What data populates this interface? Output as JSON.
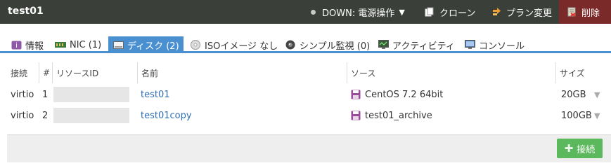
{
  "header": {
    "title": "test01",
    "power_label": "DOWN: 電源操作",
    "clone_label": "クローン",
    "plan_label": "プラン変更",
    "delete_label": "削除"
  },
  "tabs": [
    {
      "label": "情報"
    },
    {
      "label": "NIC (1)"
    },
    {
      "label": "ディスク (2)"
    },
    {
      "label": "ISOイメージ なし"
    },
    {
      "label": "シンプル監視 (0)"
    },
    {
      "label": "アクティビティ"
    },
    {
      "label": "コンソール"
    }
  ],
  "table": {
    "headers": [
      "接続",
      "#",
      "リソースID",
      "名前",
      "ソース",
      "サイズ"
    ],
    "rows": [
      {
        "connection": "virtio",
        "index": "1",
        "name": "test01",
        "source": "CentOS 7.2 64bit",
        "size": "20GB"
      },
      {
        "connection": "virtio",
        "index": "2",
        "name": "test01copy",
        "source": "test01_archive",
        "size": "100GB"
      }
    ]
  },
  "footer": {
    "connect_label": "接続"
  },
  "colors": {
    "header_bg": "#3a3f3a",
    "delete_bg": "#7b2a2a",
    "tab_active": "#4a8fd0",
    "link": "#2f6db5",
    "connect_button": "#5cb85c"
  }
}
